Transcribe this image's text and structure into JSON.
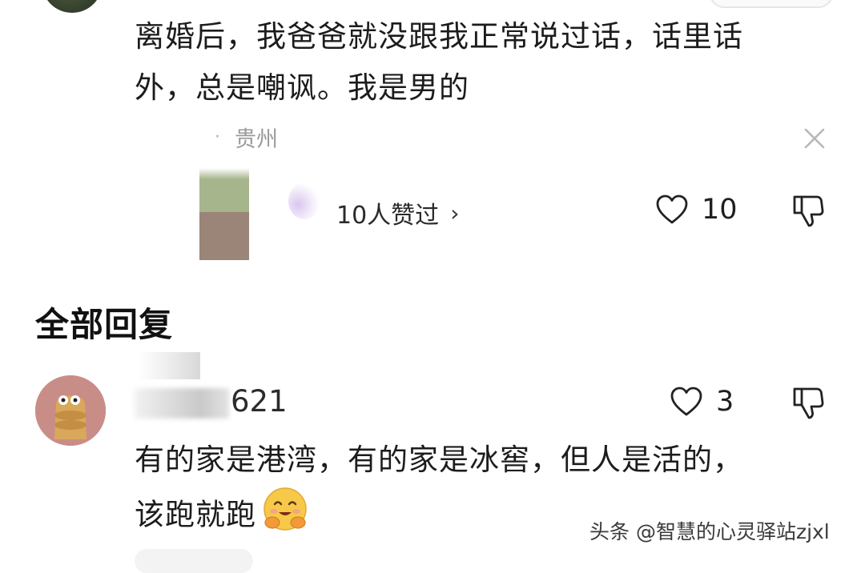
{
  "top_comment": {
    "text_line1": "离婚后，我爸爸就没跟我正常说过话，话里话",
    "text_line2": "外，总是嘲讽。我是男的",
    "location": "贵州",
    "liked_by": "10人赞过",
    "like_count": "10"
  },
  "replies_section": {
    "title": "全部回复"
  },
  "reply": {
    "username_visible": "621",
    "like_count": "3",
    "text_line1": "有的家是港湾，有的家是冰窖，但人是活的，",
    "text_line2": "该跑就跑"
  },
  "watermark": "头条 @智慧的心灵驿站zjxl",
  "icons": {
    "like": "heart-outline-icon",
    "dislike": "thumbs-down-icon",
    "close": "close-icon",
    "chevron": "chevron-right-icon"
  }
}
